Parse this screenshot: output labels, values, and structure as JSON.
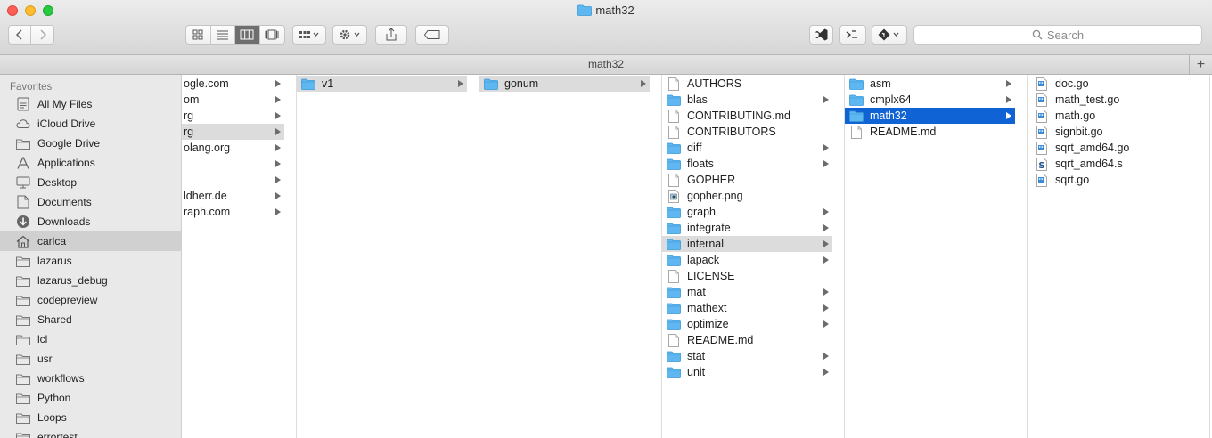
{
  "window": {
    "title": "math32"
  },
  "toolbar": {
    "search_placeholder": "Search"
  },
  "pathbar": {
    "title": "math32",
    "add_label": "+"
  },
  "sidebar": {
    "header": "Favorites",
    "items": [
      {
        "label": "All My Files",
        "icon": "all-files-icon"
      },
      {
        "label": "iCloud Drive",
        "icon": "cloud-icon"
      },
      {
        "label": "Google Drive",
        "icon": "folder-icon"
      },
      {
        "label": "Applications",
        "icon": "applications-icon"
      },
      {
        "label": "Desktop",
        "icon": "desktop-icon"
      },
      {
        "label": "Documents",
        "icon": "documents-icon"
      },
      {
        "label": "Downloads",
        "icon": "downloads-icon"
      },
      {
        "label": "carlca",
        "icon": "home-icon",
        "selected": true
      },
      {
        "label": "lazarus",
        "icon": "folder-icon"
      },
      {
        "label": "lazarus_debug",
        "icon": "folder-icon"
      },
      {
        "label": "codepreview",
        "icon": "folder-icon"
      },
      {
        "label": "Shared",
        "icon": "folder-icon"
      },
      {
        "label": "lcl",
        "icon": "folder-icon"
      },
      {
        "label": "usr",
        "icon": "folder-icon"
      },
      {
        "label": "workflows",
        "icon": "folder-icon"
      },
      {
        "label": "Python",
        "icon": "folder-icon"
      },
      {
        "label": "Loops",
        "icon": "folder-icon"
      },
      {
        "label": "errortest",
        "icon": "folder-icon"
      }
    ]
  },
  "columns": [
    {
      "items": [
        {
          "label": "ogle.com",
          "folder": true
        },
        {
          "label": "om",
          "folder": true
        },
        {
          "label": "rg",
          "folder": true
        },
        {
          "label": "rg",
          "folder": true,
          "selected": "gray"
        },
        {
          "label": "olang.org",
          "folder": true
        },
        {
          "label": "",
          "folder": true
        },
        {
          "label": "",
          "folder": true
        },
        {
          "label": "ldherr.de",
          "folder": true
        },
        {
          "label": "raph.com",
          "folder": true
        }
      ]
    },
    {
      "items": [
        {
          "label": "v1",
          "folder": true,
          "selected": "gray"
        }
      ]
    },
    {
      "items": [
        {
          "label": "gonum",
          "folder": true,
          "selected": "gray"
        }
      ]
    },
    {
      "items": [
        {
          "label": "AUTHORS",
          "folder": false,
          "icon": "document-icon"
        },
        {
          "label": "blas",
          "folder": true
        },
        {
          "label": "CONTRIBUTING.md",
          "folder": false,
          "icon": "document-icon"
        },
        {
          "label": "CONTRIBUTORS",
          "folder": false,
          "icon": "document-icon"
        },
        {
          "label": "diff",
          "folder": true
        },
        {
          "label": "floats",
          "folder": true
        },
        {
          "label": "GOPHER",
          "folder": false,
          "icon": "document-icon"
        },
        {
          "label": "gopher.png",
          "folder": false,
          "icon": "image-icon"
        },
        {
          "label": "graph",
          "folder": true
        },
        {
          "label": "integrate",
          "folder": true
        },
        {
          "label": "internal",
          "folder": true,
          "selected": "gray"
        },
        {
          "label": "lapack",
          "folder": true
        },
        {
          "label": "LICENSE",
          "folder": false,
          "icon": "document-icon"
        },
        {
          "label": "mat",
          "folder": true
        },
        {
          "label": "mathext",
          "folder": true
        },
        {
          "label": "optimize",
          "folder": true
        },
        {
          "label": "README.md",
          "folder": false,
          "icon": "document-icon"
        },
        {
          "label": "stat",
          "folder": true
        },
        {
          "label": "unit",
          "folder": true
        }
      ]
    },
    {
      "items": [
        {
          "label": "asm",
          "folder": true
        },
        {
          "label": "cmplx64",
          "folder": true
        },
        {
          "label": "math32",
          "folder": true,
          "selected": "blue"
        },
        {
          "label": "README.md",
          "folder": false,
          "icon": "document-icon"
        }
      ]
    },
    {
      "items": [
        {
          "label": "doc.go",
          "folder": false,
          "icon": "go-file-icon"
        },
        {
          "label": "math_test.go",
          "folder": false,
          "icon": "go-file-icon"
        },
        {
          "label": "math.go",
          "folder": false,
          "icon": "go-file-icon"
        },
        {
          "label": "signbit.go",
          "folder": false,
          "icon": "go-file-icon"
        },
        {
          "label": "sqrt_amd64.go",
          "folder": false,
          "icon": "go-file-icon"
        },
        {
          "label": "sqrt_amd64.s",
          "folder": false,
          "icon": "asm-file-icon"
        },
        {
          "label": "sqrt.go",
          "folder": false,
          "icon": "go-file-icon"
        }
      ]
    }
  ]
}
